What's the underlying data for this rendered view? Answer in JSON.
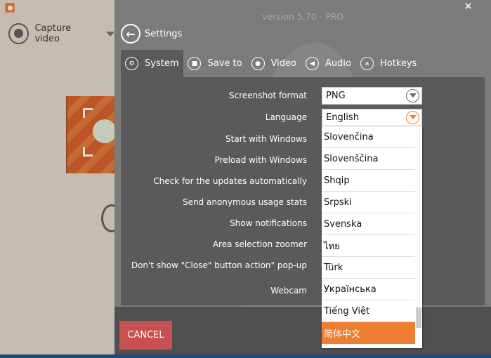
{
  "app": {
    "capture_label": "Capture video",
    "version": "version 5.70 - PRO",
    "close": "✕"
  },
  "header": {
    "title": "Settings",
    "back": "←"
  },
  "tabs": [
    {
      "label": "System",
      "icon": "gears-icon"
    },
    {
      "label": "Save to",
      "icon": "folder-icon"
    },
    {
      "label": "Video",
      "icon": "record-icon"
    },
    {
      "label": "Audio",
      "icon": "speaker-icon"
    },
    {
      "label": "Hotkeys",
      "icon": "keyboard-key-icon"
    }
  ],
  "settings": [
    "Screenshot format",
    "Language",
    "Start with Windows",
    "Preload with Windows",
    "Check for the updates automatically",
    "Send anonymous usage stats",
    "Show notifications",
    "Area selection zoomer",
    "Don't show \"Close\" button action\" pop-up",
    "Webcam"
  ],
  "screenshot_format": "PNG",
  "language": {
    "value": "English",
    "options": [
      "Slovenčina",
      "Slovenščina",
      "Shqip",
      "Srpski",
      "Svenska",
      "ไทย",
      "Türk",
      "Українська",
      "Tiếng Việt",
      "简体中文"
    ],
    "highlighted": "简体中文"
  },
  "footer": {
    "cancel": "CANCEL"
  },
  "colors": {
    "accent": "#ed7d31",
    "cancel": "#c85050",
    "panel": "#5a5a5a"
  }
}
